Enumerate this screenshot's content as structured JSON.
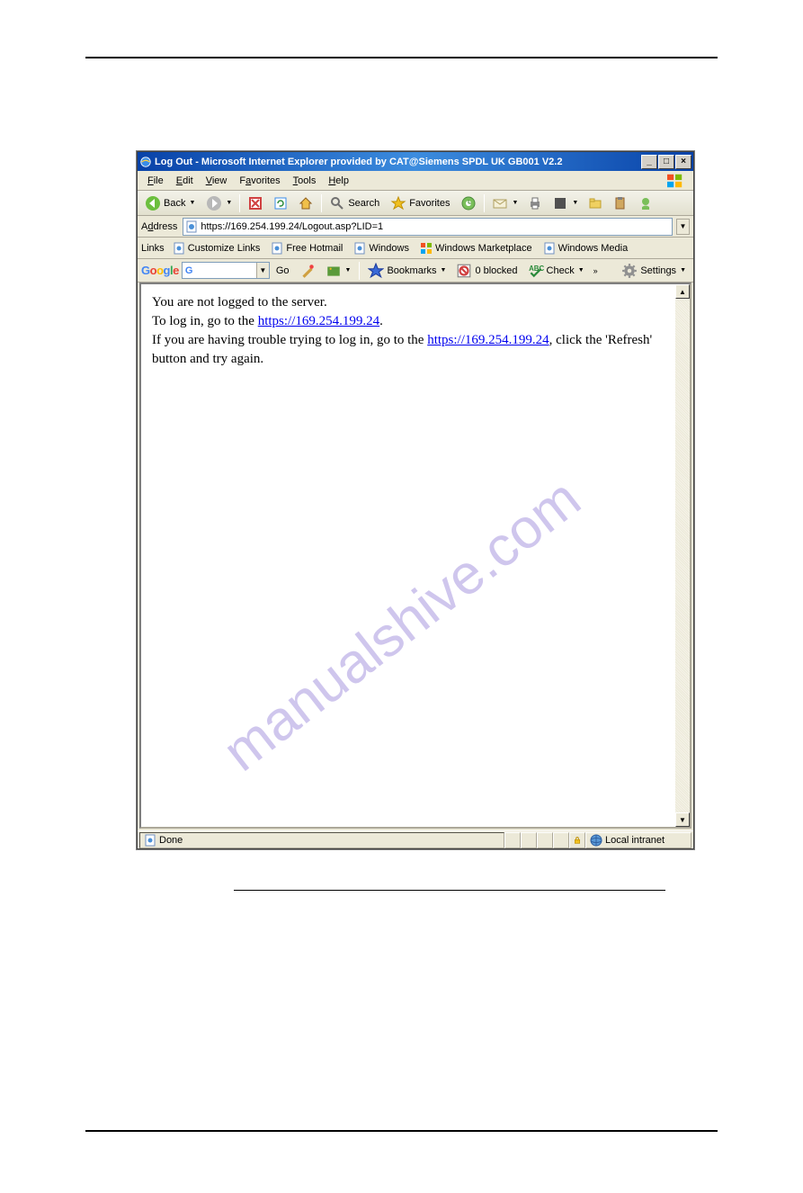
{
  "titlebar": {
    "title": "Log Out - Microsoft Internet Explorer provided by CAT@Siemens SPDL UK GB001 V2.2"
  },
  "window_controls": {
    "min": "_",
    "max": "□",
    "close": "×"
  },
  "menus": {
    "file": "File",
    "edit": "Edit",
    "view": "View",
    "favorites": "Favorites",
    "tools": "Tools",
    "help": "Help"
  },
  "toolbar": {
    "back": "Back",
    "search": "Search",
    "favorites": "Favorites"
  },
  "address": {
    "label": "Address",
    "url": "https://169.254.199.24/Logout.asp?LID=1"
  },
  "links": {
    "label": "Links",
    "customize": "Customize Links",
    "hotmail": "Free Hotmail",
    "windows": "Windows",
    "marketplace": "Windows Marketplace",
    "media": "Windows Media"
  },
  "google": {
    "go": "Go",
    "bookmarks": "Bookmarks",
    "blocked": "0 blocked",
    "check": "Check",
    "settings": "Settings"
  },
  "content": {
    "line1": "You are not logged to the server.",
    "line2_pre": "To log in, go to the ",
    "line2_link": "https://169.254.199.24",
    "line2_post": ".",
    "line3_pre": "If you are having trouble trying to log in, go to the ",
    "line3_link": "https://169.254.199.24",
    "line3_post": ", click the 'Refresh' button and try again."
  },
  "statusbar": {
    "done": "Done",
    "zone": "Local intranet"
  },
  "watermark": "manualshive.com"
}
